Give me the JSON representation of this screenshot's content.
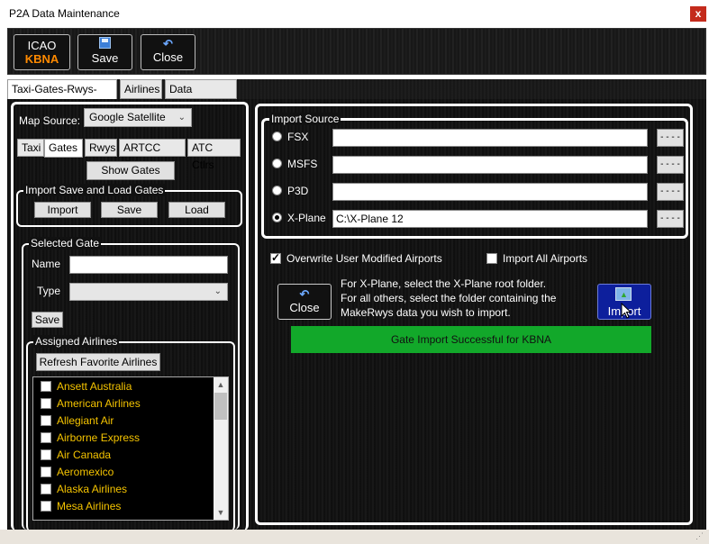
{
  "window": {
    "title": "P2A Data Maintenance",
    "close_glyph": "x"
  },
  "toolbar": {
    "icao_label": "ICAO",
    "icao_value": "KBNA",
    "save_label": "Save",
    "close_label": "Close"
  },
  "tabs": [
    "Taxi-Gates-Rwys-Ctlrs",
    "Airlines",
    "Data Updater"
  ],
  "left": {
    "map_source_label": "Map Source:",
    "map_source_value": "Google Satellite",
    "subtabs": [
      "Taxi",
      "Gates",
      "Rwys",
      "ARTCC Ctlrs",
      "ATC Ctlrs"
    ],
    "show_gates": "Show Gates",
    "import_group": {
      "title": "Import Save and Load Gates",
      "import": "Import",
      "save": "Save",
      "load": "Load"
    },
    "selected_gate": {
      "title": "Selected Gate",
      "name_label": "Name",
      "name_value": "",
      "type_label": "Type",
      "type_value": "",
      "save": "Save"
    },
    "assigned_airlines": {
      "title": "Assigned Airlines",
      "refresh": "Refresh Favorite Airlines",
      "items": [
        "Ansett Australia",
        "American Airlines",
        "Allegiant Air",
        "Airborne Express",
        "Air Canada",
        "Aeromexico",
        "Alaska Airlines",
        "Mesa Airlines"
      ]
    }
  },
  "right": {
    "import_source_title": "Import Source",
    "sources": [
      {
        "label": "FSX",
        "path": "",
        "selected": false
      },
      {
        "label": "MSFS",
        "path": "",
        "selected": false
      },
      {
        "label": "P3D",
        "path": "",
        "selected": false
      },
      {
        "label": "X-Plane",
        "path": "C:\\X-Plane 12",
        "selected": true
      }
    ],
    "browse_label": "- - - -",
    "overwrite_label": "Overwrite User Modified Airports",
    "overwrite_checked": true,
    "import_all_label": "Import All Airports",
    "import_all_checked": false,
    "close_label": "Close",
    "help_lines": [
      "For X-Plane, select the X-Plane root folder.",
      "For all others, select the folder containing the",
      "MakeRwys data you wish to import."
    ],
    "import_label": "Import",
    "status_message": "Gate Import Successful for KBNA"
  },
  "colors": {
    "accent_orange": "#ff8a00",
    "airline_yellow": "#f5c400",
    "status_green": "#12a82a",
    "import_blue": "#0d1f9c",
    "close_red": "#c42b1c"
  }
}
